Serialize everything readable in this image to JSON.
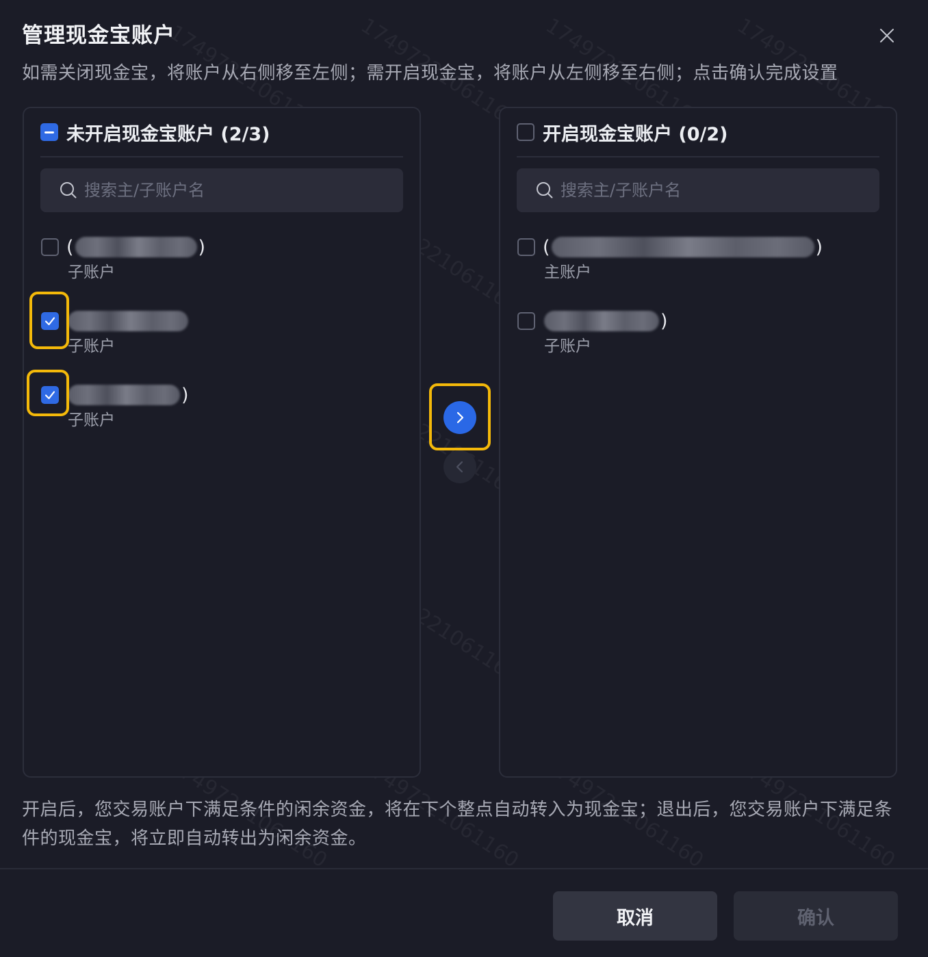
{
  "dialog": {
    "title": "管理现金宝账户",
    "subtitle": "如需关闭现金宝，将账户从右侧移至左侧；需开启现金宝，将账户从左侧移至右侧；点击确认完成设置",
    "note": "开启后，您交易账户下满足条件的闲余资金，将在下个整点自动转入为现金宝；退出后，您交易账户下满足条件的现金宝，将立即自动转出为闲余资金。"
  },
  "left_panel": {
    "title": "未开启现金宝账户 (2/3)",
    "search_placeholder": "搜索主/子账户名",
    "items": [
      {
        "prefix": "(",
        "suffix": ")",
        "type": "子账户",
        "checked": false
      },
      {
        "prefix": "",
        "suffix": "",
        "type": "子账户",
        "checked": true
      },
      {
        "prefix": "",
        "suffix": ")",
        "type": "子账户",
        "checked": true
      }
    ]
  },
  "right_panel": {
    "title": "开启现金宝账户 (0/2)",
    "search_placeholder": "搜索主/子账户名",
    "items": [
      {
        "prefix": "(",
        "suffix": ")",
        "type": "主账户",
        "checked": false
      },
      {
        "prefix": "",
        "suffix": ")",
        "type": "子账户",
        "checked": false
      }
    ]
  },
  "buttons": {
    "cancel": "取消",
    "confirm": "确认"
  },
  "watermark": "17497221061160",
  "colors": {
    "background": "#1b1c27",
    "accent": "#2a68e6",
    "highlight": "#f4b90a"
  }
}
